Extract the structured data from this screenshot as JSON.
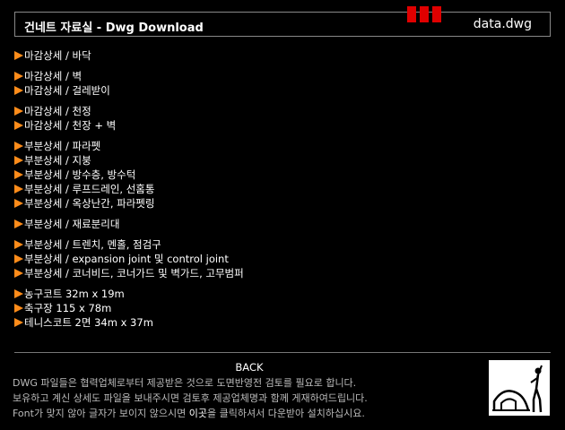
{
  "header": {
    "title": "건네트 자료실 - Dwg Download",
    "file_label": "data.dwg"
  },
  "groups": [
    {
      "items": [
        "마감상세 / 바닥"
      ]
    },
    {
      "items": [
        "마감상세 / 벽",
        "마감상세 / 걸레받이"
      ]
    },
    {
      "items": [
        "마감상세 / 천정",
        "마감상세 / 천장 + 벽"
      ]
    },
    {
      "items": [
        "부분상세 / 파라펫",
        "부분상세 / 지붕",
        "부분상세 / 방수층, 방수턱",
        "부분상세 / 루프드레인, 선홈통",
        "부분상세 / 옥상난간, 파라펫링"
      ]
    },
    {
      "items": [
        "부분상세 / 재료분리대"
      ]
    },
    {
      "items": [
        "부분상세 / 트렌치, 멘홀, 점검구",
        "부분상세 / expansion joint 및 control joint",
        "부분상세 / 코너비드, 코너가드 및 벽가드, 고무범퍼"
      ]
    },
    {
      "items": [
        "농구코트 32m x 19m",
        "축구장 115 x 78m",
        "테니스코트 2면 34m x 37m"
      ]
    }
  ],
  "footer": {
    "back_label": "BACK",
    "line1": "DWG 파일들은 협력업체로부터 제공받은 것으로 도면반영전 검토를 필요로 합니다.",
    "line2": "보유하고 계신 상세도 파일을 보내주시면 검토후 제공업체명과 함께 게재하여드립니다.",
    "line3_pre": "Font가 맞지 않아 글자가 보이지 않으시면 ",
    "line3_link": "이곳",
    "line3_post": "을 클릭하셔서 다운받아 설치하십시요."
  },
  "colors": {
    "background": "#000000",
    "arrow": "#ff8c1a",
    "header_blocks": "#e00000"
  },
  "icons": {
    "bullet": "orange-triangle-arrow",
    "logo": "human-figure-logo"
  }
}
